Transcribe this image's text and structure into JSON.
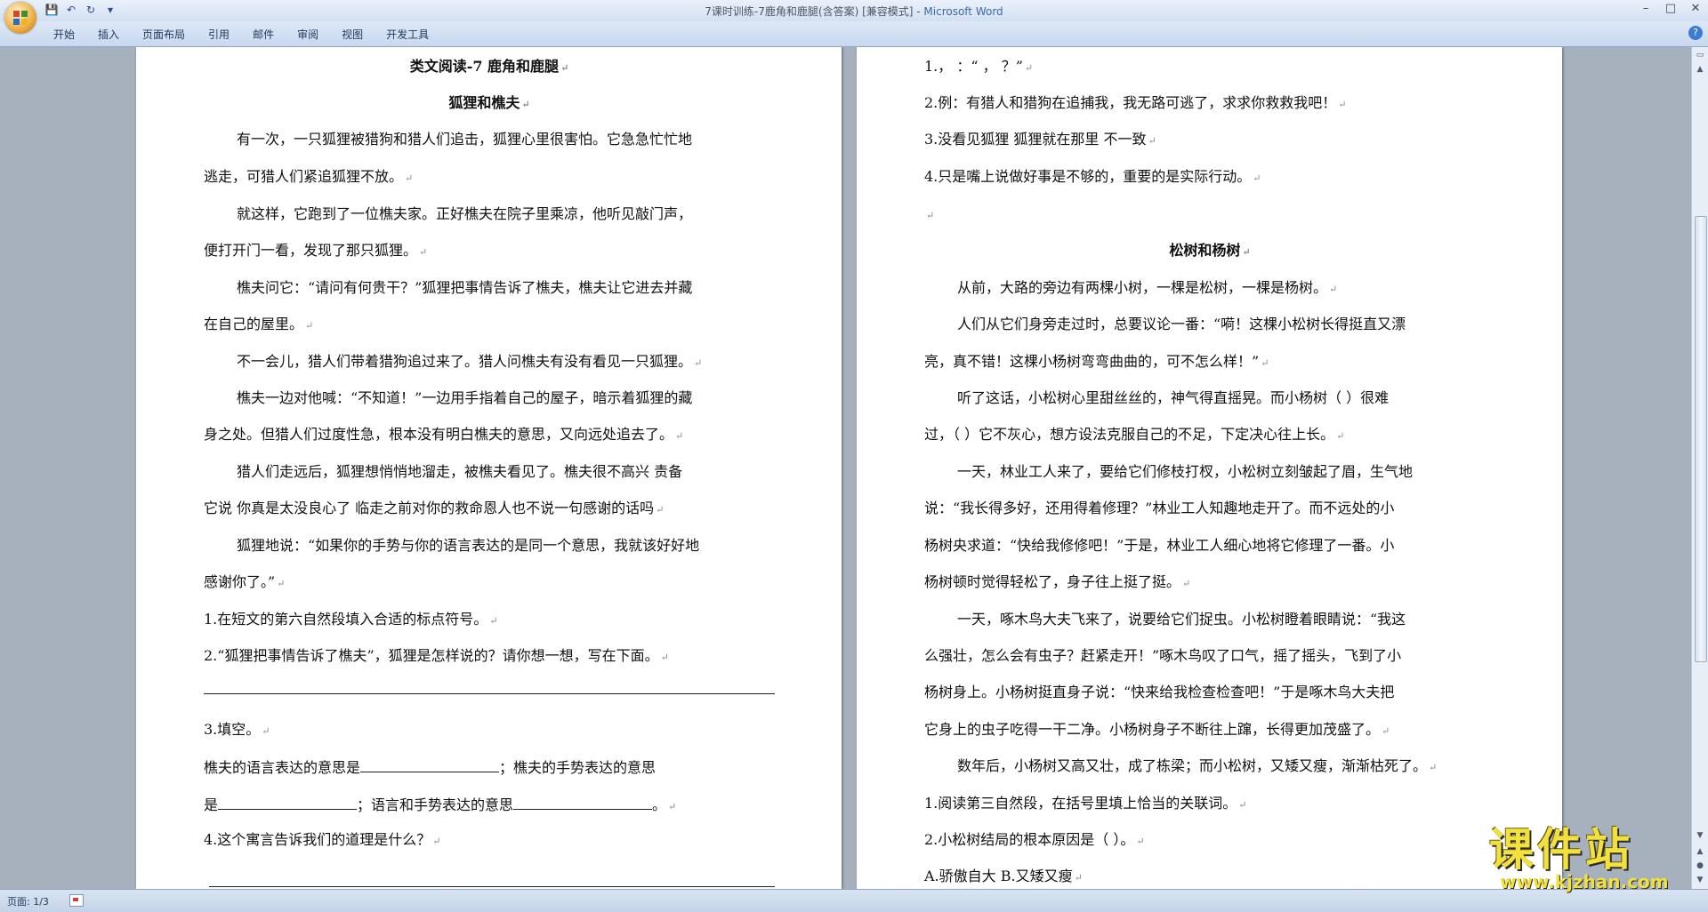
{
  "window": {
    "title": "7课时训练-7鹿角和鹿腿(含答案) [兼容模式] - ",
    "app": "Microsoft Word",
    "controls": [
      "–",
      "□",
      "✕"
    ]
  },
  "quick_access": [
    "save-icon",
    "undo-icon",
    "redo-icon",
    "customize-icon"
  ],
  "ribbon": {
    "tabs": [
      "开始",
      "插入",
      "页面布局",
      "引用",
      "邮件",
      "审阅",
      "视图",
      "开发工具"
    ]
  },
  "page1": {
    "title": "类文阅读-7 鹿角和鹿腿",
    "subtitle": "狐狸和樵夫",
    "lines": [
      "有一次，一只狐狸被猎狗和猎人们追击，狐狸心里很害怕。它急急忙忙地",
      "逃走，可猎人们紧追狐狸不放。",
      "就这样，它跑到了一位樵夫家。正好樵夫在院子里乘凉，他听见敲门声，",
      "便打开门一看，发现了那只狐狸。",
      "樵夫问它：“请问有何贵干？”狐狸把事情告诉了樵夫，樵夫让它进去并藏",
      "在自己的屋里。",
      "不一会儿，猎人们带着猎狗追过来了。猎人问樵夫有没有看见一只狐狸。",
      "樵夫一边对他喊：“不知道！”一边用手指着自己的屋子，暗示着狐狸的藏",
      "身之处。但猎人们过度性急，根本没有明白樵夫的意思，又向远处追去了。",
      "猎人们走远后，狐狸想悄悄地溜走，被樵夫看见了。樵夫很不高兴  责备",
      "它说  你真是太没良心了  临走之前对你的救命恩人也不说一句感谢的话吗",
      "狐狸地说：“如果你的手势与你的语言表达的是同一个意思，我就该好好地",
      "感谢你了。”",
      "1.在短文的第六自然段填入合适的标点符号。",
      "2.“狐狸把事情告诉了樵夫”，狐狸是怎样说的？请你想一想，写在下面。",
      "3.填空。"
    ],
    "fill1_a": "樵夫的语言表达的意思是",
    "fill1_b": "；樵夫的手势表达的意思",
    "fill2_a": "是",
    "fill2_b": "；语言和手势表达的意思",
    "fill2_c": "。",
    "q4": "4.这个寓言告诉我们的道理是什么？"
  },
  "page2": {
    "lines_top": [
      "1.，   ：“    ，    ？”",
      "2.例：有猎人和猎狗在追捕我，我无路可逃了，求求你救救我吧！",
      "3.没看见狐狸    狐狸就在那里    不一致",
      "4.只是嘴上说做好事是不够的，重要的是实际行动。",
      ""
    ],
    "subtitle": "松树和杨树",
    "lines": [
      "从前，大路的旁边有两棵小树，一棵是松树，一棵是杨树。",
      "人们从它们身旁走过时，总要议论一番：“嗬！这棵小松树长得挺直又漂",
      "亮，真不错！这棵小杨树弯弯曲曲的，可不怎么样！”",
      "听了这话，小松树心里甜丝丝的，神气得直摇晃。而小杨树（     ）很难",
      "过，（     ）它不灰心，想方设法克服自己的不足，下定决心往上长。",
      "一天，林业工人来了，要给它们修枝打杈，小松树立刻皱起了眉，生气地",
      "说：“我长得多好，还用得着修理？”林业工人知趣地走开了。而不远处的小",
      "杨树央求道：“快给我修修吧！”于是，林业工人细心地将它修理了一番。小",
      "杨树顿时觉得轻松了，身子往上挺了挺。",
      "一天，啄木鸟大夫飞来了，说要给它们捉虫。小松树瞪着眼睛说：“我这",
      "么强壮，怎么会有虫子？赶紧走开！”啄木鸟叹了口气，摇了摇头，飞到了小",
      "杨树身上。小杨树挺直身子说：“快来给我检查检查吧！”于是啄木鸟大夫把",
      "它身上的虫子吃得一干二净。小杨树身子不断往上蹿，长得更加茂盛了。",
      "数年后，小杨树又高又壮，成了栋梁；而小松树，又矮又瘦，渐渐枯死了。",
      "1.阅读第三自然段，在括号里填上恰当的关联词。",
      "2.小松树结局的根本原因是（     ）。",
      "A.骄傲自大                B.又矮又瘦"
    ]
  },
  "status": {
    "page": "页面: 1/3"
  },
  "watermark": {
    "main": "课件站",
    "url": "www.kjzhan.com"
  }
}
